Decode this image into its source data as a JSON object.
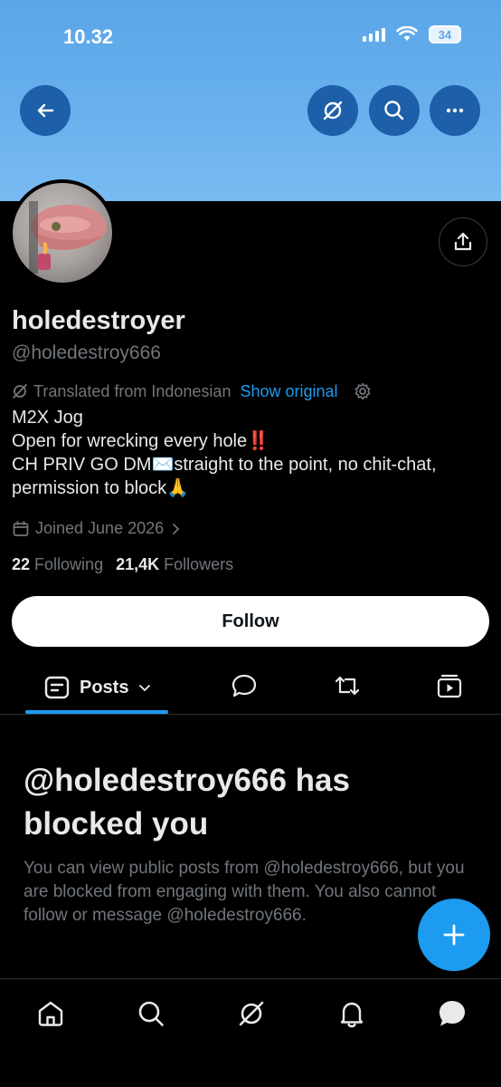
{
  "status_bar": {
    "time": "10.32",
    "battery": "34"
  },
  "profile": {
    "display_name": "holedestroyer",
    "handle": "@holedestroy666",
    "translated_from": "Translated from Indonesian",
    "show_original": "Show original",
    "bio_lines": [
      "M2X Jog",
      "Open for wrecking every hole‼️",
      "CH PRIV GO DM✉️straight to the point, no chit-chat,",
      "permission to block🙏"
    ],
    "joined": "Joined June 2026",
    "following_count": "22",
    "following_label": "Following",
    "followers_count": "21,4K",
    "followers_label": "Followers",
    "follow_label": "Follow"
  },
  "tabs": {
    "posts_label": "Posts"
  },
  "blocked": {
    "title": "@holedestroy666 has blocked you",
    "text": "You can view public posts from @holedestroy666, but you are blocked from engaging with them. You also cannot follow or message @holedestroy666."
  },
  "colors": {
    "accent": "#1d9bf0",
    "banner": "#6ab1ee",
    "follow_button": "#ffffff"
  },
  "icons": [
    "back-arrow-icon",
    "grok-icon",
    "search-icon",
    "more-icon",
    "share-icon",
    "translate-icon",
    "settings-icon",
    "calendar-icon",
    "chevron-right-icon",
    "posts-icon",
    "chevron-down-icon",
    "reply-icon",
    "repost-icon",
    "media-icon",
    "plus-icon",
    "home-icon",
    "notifications-icon",
    "messages-icon"
  ]
}
